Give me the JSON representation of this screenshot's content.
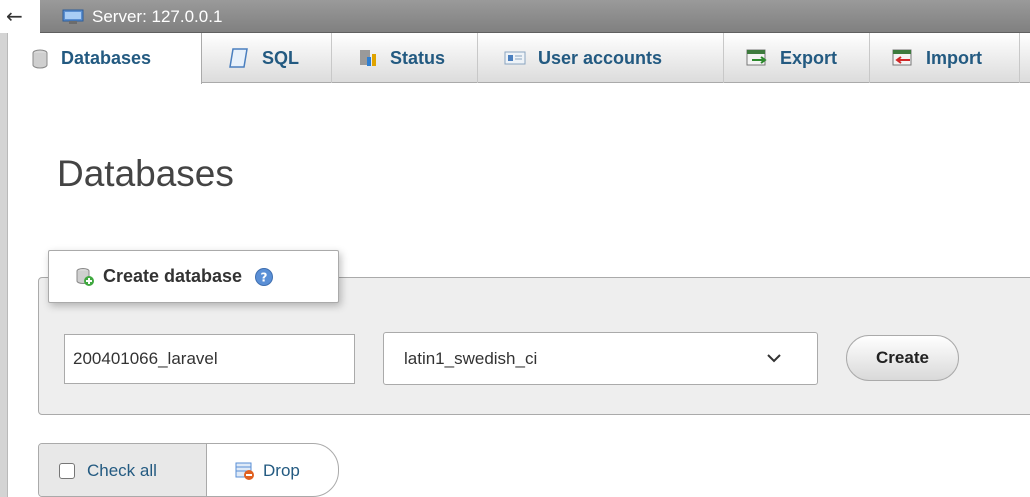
{
  "topbar": {
    "back_glyph": "←",
    "server_label": "Server: 127.0.0.1",
    "server_icon": "server-icon"
  },
  "tabs": [
    {
      "label": "Databases",
      "icon": "database-icon",
      "active": true
    },
    {
      "label": "SQL",
      "icon": "sql-icon",
      "active": false
    },
    {
      "label": "Status",
      "icon": "status-icon",
      "active": false
    },
    {
      "label": "User accounts",
      "icon": "user-accounts-icon",
      "active": false
    },
    {
      "label": "Export",
      "icon": "export-icon",
      "active": false
    },
    {
      "label": "Import",
      "icon": "import-icon",
      "active": false
    }
  ],
  "page": {
    "title": "Databases"
  },
  "create_database": {
    "legend": "Create database",
    "db_name_value": "200401066_laravel",
    "collation_selected": "latin1_swedish_ci",
    "create_label": "Create"
  },
  "actions": {
    "check_all_label": "Check all",
    "drop_label": "Drop"
  },
  "colors": {
    "link": "#235a81",
    "topbar": "#8c8c8c",
    "fieldset_bg": "#eeeeee"
  }
}
